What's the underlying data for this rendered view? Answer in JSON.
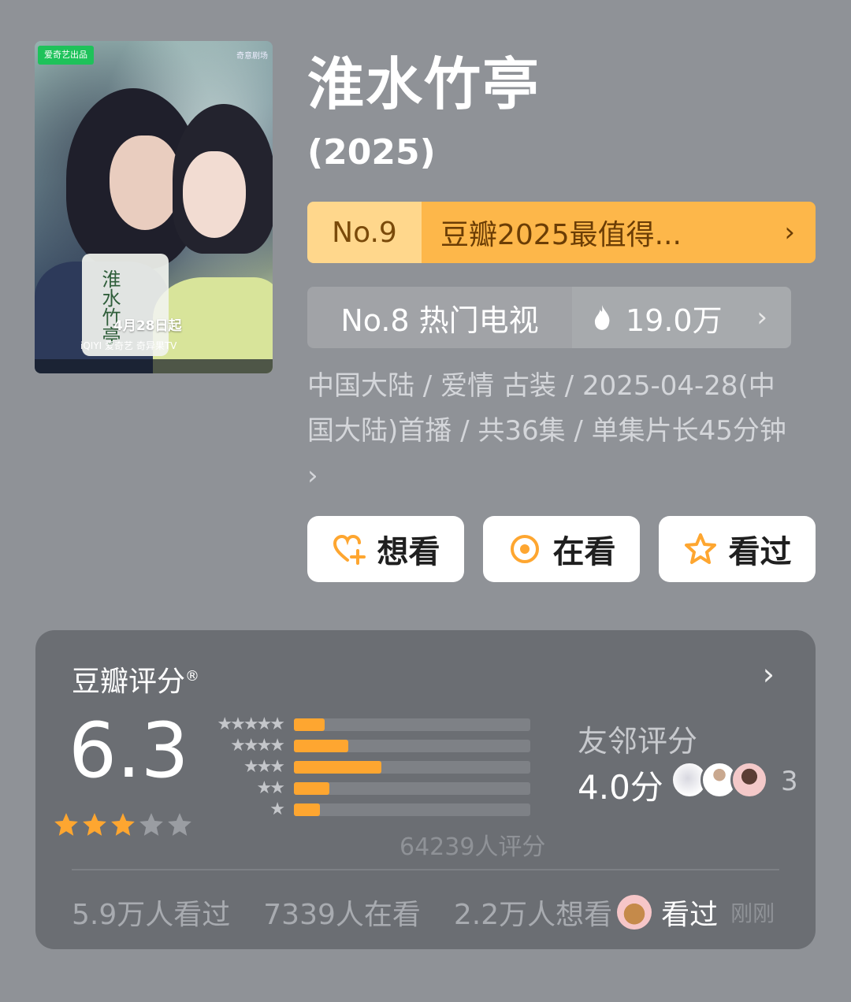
{
  "poster": {
    "badge": "爱奇艺出品",
    "brand_right": "奇意剧场",
    "vertical_title": "淮水竹亭",
    "release_text": "4月28日起",
    "platforms": "iQIYI 爱奇艺  奇异果TV"
  },
  "show": {
    "title": "淮水竹亭",
    "year": "(2025)"
  },
  "rank_primary": {
    "no": "No.9",
    "text": "豆瓣2025最值得...",
    "chevron": "›"
  },
  "rank_secondary": {
    "label": "No.8 热门电视",
    "heat": "19.0万",
    "chevron": "›",
    "icon": "flame-icon"
  },
  "meta": {
    "line": "中国大陆 / 爱情 古装 / 2025-04-28(中国大陆)首播 / 共36集 / 单集片长45分钟 ›"
  },
  "actions": {
    "want": "想看",
    "watching": "在看",
    "watched": "看过"
  },
  "rating": {
    "header": "豆瓣评分",
    "registered": "®",
    "chevron": "›",
    "score": "6.3",
    "stars_filled": 3,
    "stars_total": 5,
    "distribution": [
      {
        "stars": "★★★★★",
        "fraction": 0.13
      },
      {
        "stars": "★★★★",
        "fraction": 0.23
      },
      {
        "stars": "★★★",
        "fraction": 0.37
      },
      {
        "stars": "★★",
        "fraction": 0.15
      },
      {
        "stars": "★",
        "fraction": 0.11
      }
    ],
    "total": "64239人评分",
    "friend_label": "友邻评分",
    "friend_score": "4.0分",
    "friend_count": "3"
  },
  "footer": {
    "watched": "5.9万人看过",
    "watching": "7339人在看",
    "want": "2.2万人想看",
    "latest_action": "看过",
    "latest_time": "刚刚"
  },
  "colors": {
    "background": "#8f9297",
    "accent_orange": "#fea630",
    "star": "#fea630",
    "rank_gold": "#fdb74a"
  }
}
